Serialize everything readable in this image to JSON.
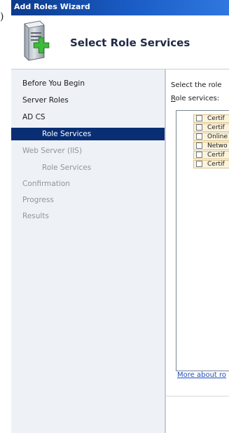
{
  "page_marker": ")",
  "window": {
    "title": "Add Roles Wizard",
    "heading": "Select Role Services"
  },
  "nav": {
    "items": [
      {
        "label": "Before You Begin",
        "level": 0,
        "state": "normal"
      },
      {
        "label": "Server Roles",
        "level": 0,
        "state": "normal"
      },
      {
        "label": "AD CS",
        "level": 0,
        "state": "normal"
      },
      {
        "label": "Role Services",
        "level": 1,
        "state": "active"
      },
      {
        "label": "Web Server (IIS)",
        "level": 0,
        "state": "dim"
      },
      {
        "label": "Role Services",
        "level": 1,
        "state": "dim"
      },
      {
        "label": "Confirmation",
        "level": 0,
        "state": "dim"
      },
      {
        "label": "Progress",
        "level": 0,
        "state": "dim"
      },
      {
        "label": "Results",
        "level": 0,
        "state": "dim"
      }
    ]
  },
  "content": {
    "intro": "Select the role",
    "role_services_label_hotkey": "R",
    "role_services_label_rest": "ole services:",
    "services": [
      {
        "label": "Certif",
        "checked": false
      },
      {
        "label": "Certif",
        "checked": false
      },
      {
        "label": "Online",
        "checked": false
      },
      {
        "label": "Netwo",
        "checked": false
      },
      {
        "label": "Certif",
        "checked": false
      },
      {
        "label": "Certif",
        "checked": false
      }
    ],
    "more_link": "More about ro"
  },
  "colors": {
    "titlebar": "#1a5cc6",
    "nav_active": "#0a2e74",
    "nav_dim_text": "#8f969f",
    "row_highlight": "#fbf3dc",
    "link": "#1f4fb8"
  },
  "icons": {
    "wizard_icon": "server-with-green-plus-icon"
  }
}
